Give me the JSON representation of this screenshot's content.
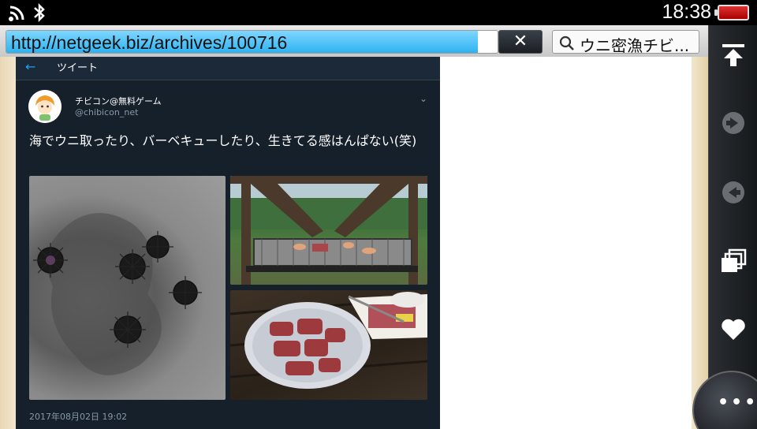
{
  "status_bar": {
    "time": "18:38",
    "icons": [
      "wifi-icon",
      "bluetooth-icon",
      "battery-icon"
    ]
  },
  "browser": {
    "url": "http://netgeek.biz/archives/100716",
    "load_progress": 0.96,
    "clear_label": "✕",
    "search_value": "ウニ密漁チビ..."
  },
  "rail": {
    "icons": [
      "scroll-top-icon",
      "forward-icon",
      "back-icon",
      "windows-icon",
      "favorite-icon",
      "more-icon"
    ],
    "more_label": "•••"
  },
  "tweet": {
    "header_back": "←",
    "header_title": "ツイート",
    "display_name": "チビコン@無料ゲーム",
    "handle": "@chibicon_net",
    "text": "海でウニ取ったり、バーベキューしたり、生きてる感はんぱない(笑)",
    "timestamp": "2017年08月02日 19:02",
    "caret": "⌄"
  },
  "colors": {
    "tweet_bg": "#15202b",
    "link_blue": "#1da1f2",
    "progress_blue": "#2fb2f0"
  }
}
